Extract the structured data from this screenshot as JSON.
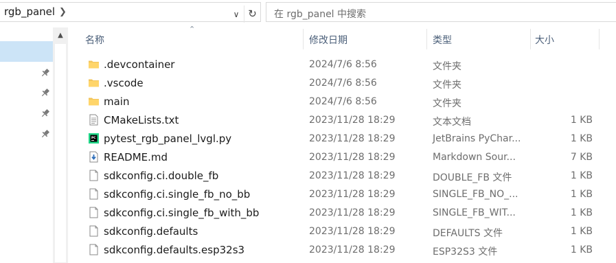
{
  "address_bar": {
    "breadcrumb": "rgb_panel",
    "search_placeholder": "在 rgb_panel 中搜索"
  },
  "columns": {
    "name": "名称",
    "date": "修改日期",
    "type": "类型",
    "size": "大小"
  },
  "files": [
    {
      "name": ".devcontainer",
      "date": "2024/7/6 8:56",
      "type": "文件夹",
      "size": "",
      "icon": "folder-icon"
    },
    {
      "name": ".vscode",
      "date": "2024/7/6 8:56",
      "type": "文件夹",
      "size": "",
      "icon": "folder-icon"
    },
    {
      "name": "main",
      "date": "2024/7/6 8:56",
      "type": "文件夹",
      "size": "",
      "icon": "folder-icon"
    },
    {
      "name": "CMakeLists.txt",
      "date": "2023/11/28 18:29",
      "type": "文本文档",
      "size": "1 KB",
      "icon": "text-file-icon"
    },
    {
      "name": "pytest_rgb_panel_lvgl.py",
      "date": "2023/11/28 18:29",
      "type": "JetBrains PyChar...",
      "size": "1 KB",
      "icon": "pycharm-file-icon"
    },
    {
      "name": "README.md",
      "date": "2023/11/28 18:29",
      "type": "Markdown Sour...",
      "size": "7 KB",
      "icon": "markdown-file-icon"
    },
    {
      "name": "sdkconfig.ci.double_fb",
      "date": "2023/11/28 18:29",
      "type": "DOUBLE_FB 文件",
      "size": "1 KB",
      "icon": "file-icon"
    },
    {
      "name": "sdkconfig.ci.single_fb_no_bb",
      "date": "2023/11/28 18:29",
      "type": "SINGLE_FB_NO_...",
      "size": "1 KB",
      "icon": "file-icon"
    },
    {
      "name": "sdkconfig.ci.single_fb_with_bb",
      "date": "2023/11/28 18:29",
      "type": "SINGLE_FB_WIT...",
      "size": "1 KB",
      "icon": "file-icon"
    },
    {
      "name": "sdkconfig.defaults",
      "date": "2023/11/28 18:29",
      "type": "DEFAULTS 文件",
      "size": "1 KB",
      "icon": "file-icon"
    },
    {
      "name": "sdkconfig.defaults.esp32s3",
      "date": "2023/11/28 18:29",
      "type": "ESP32S3 文件",
      "size": "1 KB",
      "icon": "file-icon"
    }
  ],
  "colors": {
    "folder": "#f2c55c",
    "selection": "#cce4f7",
    "header_text": "#4c607a",
    "pycharm_green": "#21d789"
  }
}
